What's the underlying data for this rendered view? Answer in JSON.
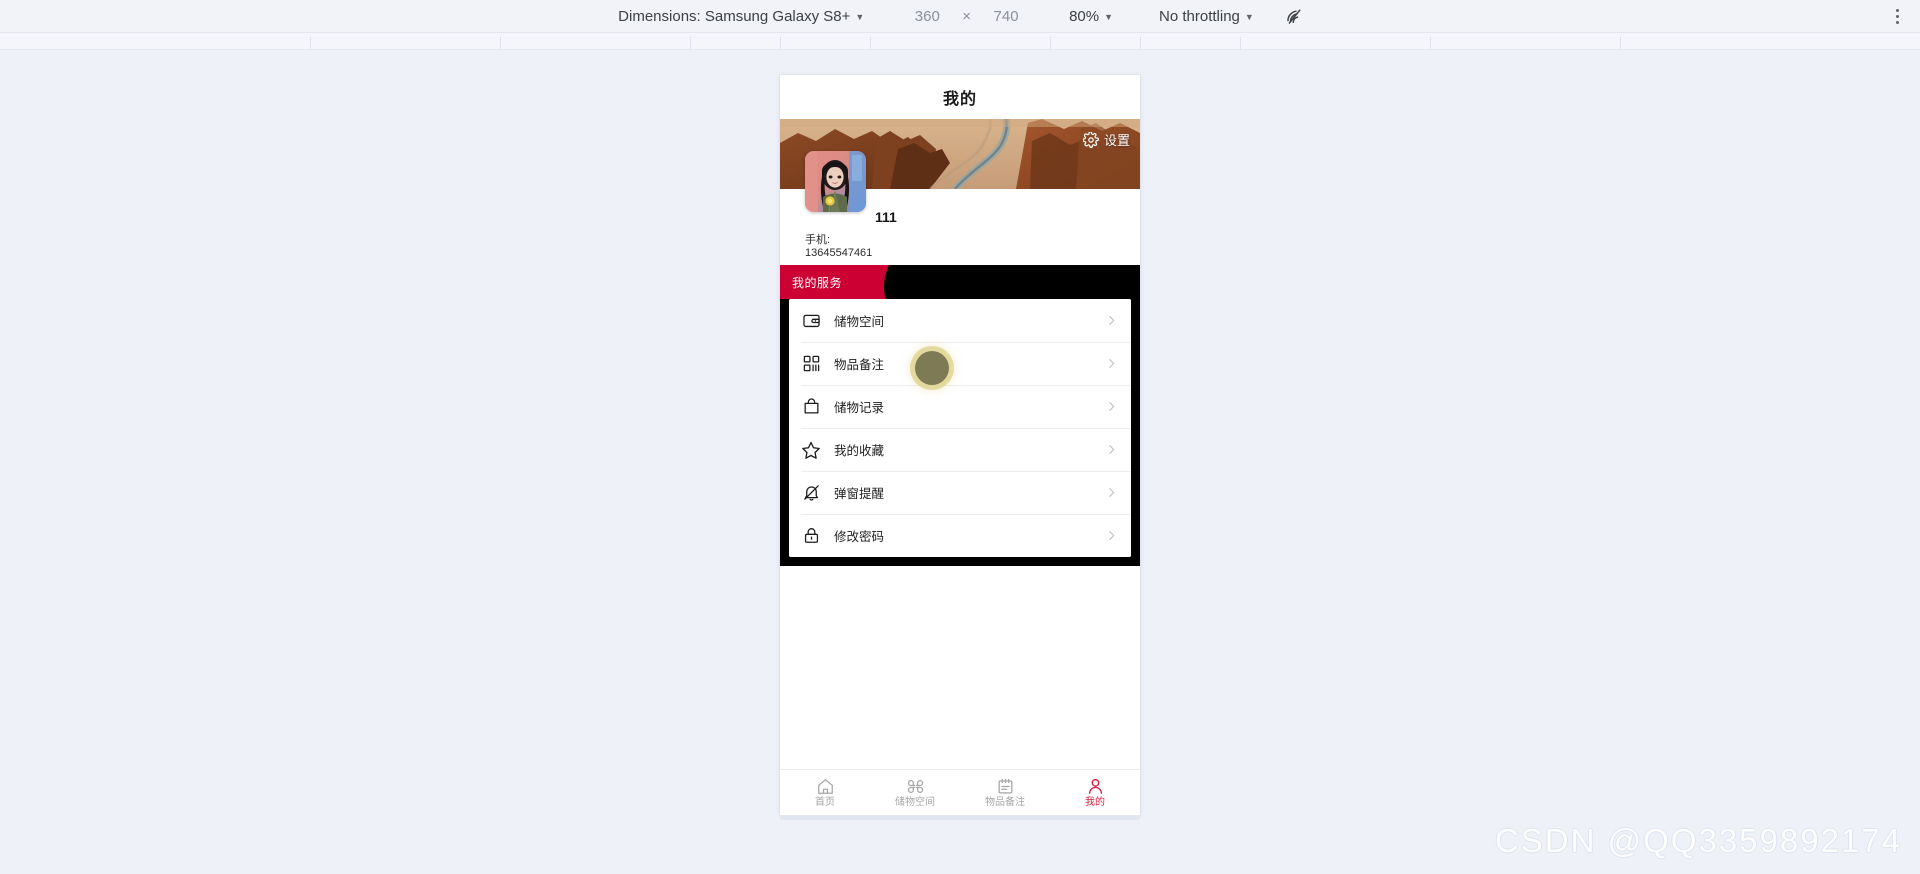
{
  "devtools_toolbar": {
    "dimensions_label": "Dimensions: Samsung Galaxy S8+",
    "width_value": "360",
    "times_symbol": "×",
    "height_value": "740",
    "zoom_label": "80%",
    "throttling_label": "No throttling",
    "throttle_icon": "wifi-throttle-icon",
    "kebab_icon": "more-vertical-icon",
    "caret_icon": "caret-down-icon"
  },
  "app": {
    "title": "我的",
    "banner": {
      "alt": "desert-canyon-road-banner",
      "settings_label": "设置",
      "settings_icon": "gear-icon"
    },
    "profile": {
      "avatar_alt": "user-avatar-photo",
      "name": "111",
      "phone_label": "手机:",
      "phone_value": "13645547461"
    },
    "services": {
      "section_title": "我的服务",
      "accent_color": "#cc0033",
      "panel_color": "#000000",
      "items": [
        {
          "label": "储物空间",
          "icon": "wallet-icon",
          "chevron": "chevron-right-icon"
        },
        {
          "label": "物品备注",
          "icon": "qr-grid-icon",
          "chevron": "chevron-right-icon"
        },
        {
          "label": "储物记录",
          "icon": "shopping-bag-icon",
          "chevron": "chevron-right-icon"
        },
        {
          "label": "我的收藏",
          "icon": "star-icon",
          "chevron": "chevron-right-icon"
        },
        {
          "label": "弹窗提醒",
          "icon": "bell-off-icon",
          "chevron": "chevron-right-icon"
        },
        {
          "label": "修改密码",
          "icon": "lock-icon",
          "chevron": "chevron-right-icon"
        }
      ]
    },
    "tabbar": {
      "active_color": "#d81e3f",
      "inactive_color": "#a6a6a6",
      "tabs": [
        {
          "label": "首页",
          "icon": "home-icon",
          "active": false
        },
        {
          "label": "储物空间",
          "icon": "clover-grid-icon",
          "active": false
        },
        {
          "label": "物品备注",
          "icon": "note-icon",
          "active": false
        },
        {
          "label": "我的",
          "icon": "person-icon",
          "active": true
        }
      ]
    }
  },
  "overlay": {
    "touch_indicator": "touch-point-indicator",
    "watermark": "CSDN @QQ3359892174"
  }
}
